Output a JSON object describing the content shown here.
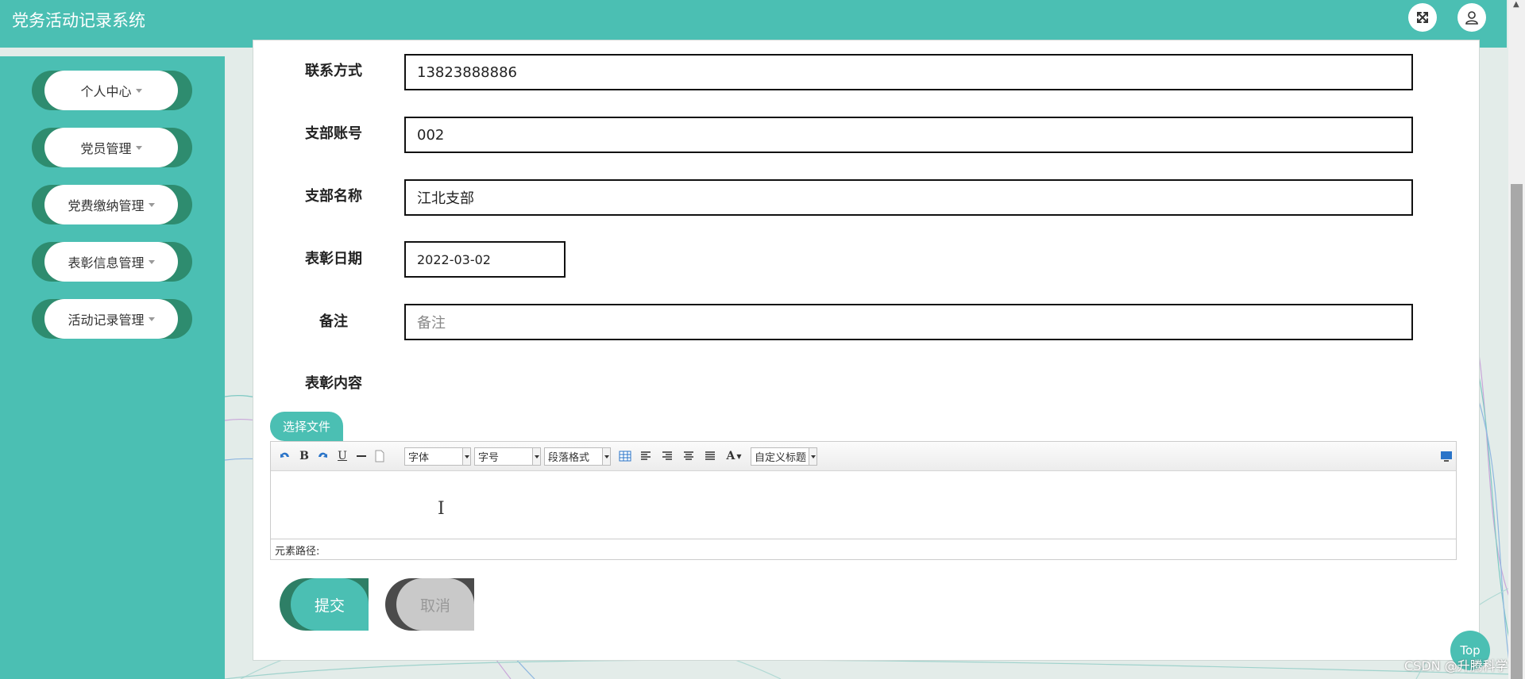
{
  "header": {
    "title": "党务活动记录系统",
    "fullscreen_icon": "expand-arrows-icon",
    "user_icon": "user-icon"
  },
  "sidebar": {
    "items": [
      {
        "label": "个人中心"
      },
      {
        "label": "党员管理"
      },
      {
        "label": "党费缴纳管理"
      },
      {
        "label": "表彰信息管理"
      },
      {
        "label": "活动记录管理"
      }
    ]
  },
  "form": {
    "phone": {
      "label": "联系方式",
      "value": "13823888886"
    },
    "branch_account": {
      "label": "支部账号",
      "value": "002"
    },
    "branch_name": {
      "label": "支部名称",
      "value": "江北支部"
    },
    "commend_date": {
      "label": "表彰日期",
      "value": "2022-03-02"
    },
    "remark": {
      "label": "备注",
      "placeholder": "备注"
    },
    "content": {
      "label": "表彰内容"
    }
  },
  "editor": {
    "choose_file": "选择文件",
    "font_select": "字体",
    "size_select": "字号",
    "paragraph_select": "段落格式",
    "custom_title_select": "自定义标题",
    "bold": "B",
    "underline": "U",
    "font_color": "A",
    "element_path": "元素路径:"
  },
  "actions": {
    "submit": "提交",
    "cancel": "取消"
  },
  "misc": {
    "top_button": "Top",
    "watermark": "CSDN @升腾科学"
  },
  "colors": {
    "primary": "#4bbfb3",
    "primary_dark": "#2e8c6f",
    "cancel_bg": "#c9c9c9"
  }
}
